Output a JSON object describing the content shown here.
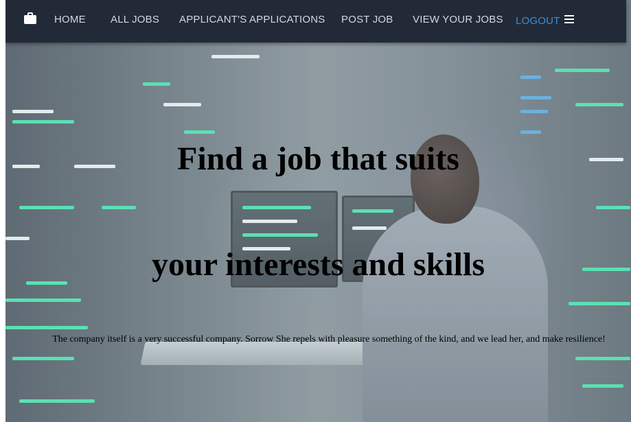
{
  "nav": {
    "brand_icon": "briefcase-icon",
    "items": [
      {
        "label": "HOME"
      },
      {
        "label": "ALL JOBS"
      },
      {
        "label": "APPLICANT'S APPLICATIONS"
      },
      {
        "label": "POST JOB"
      },
      {
        "label": "VIEW YOUR JOBS"
      },
      {
        "label": "LOGOUT"
      }
    ],
    "menu_icon": "hamburger-menu-icon"
  },
  "hero": {
    "headline_line1": "Find a job that suits",
    "headline_line2": "your interests and skills",
    "tagline": "The company itself is a very successful company. Sorrow She repels with pleasure something of the kind, and we lead her, and make resilience!"
  },
  "colors": {
    "nav_bg": "#222a38",
    "nav_text": "#d3d8dd",
    "active_link": "#3a8fd8"
  }
}
